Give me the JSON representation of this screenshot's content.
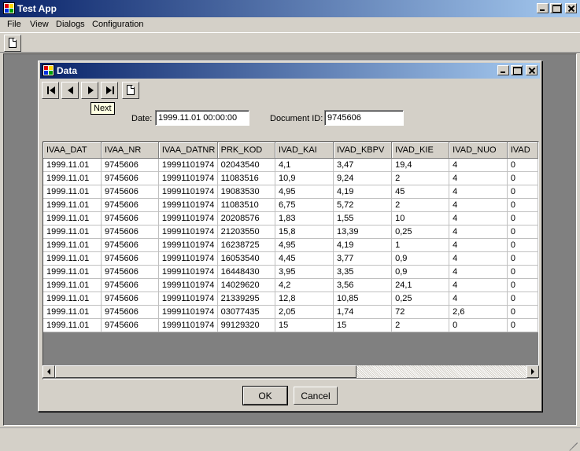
{
  "app": {
    "title": "Test App",
    "icon": "app-icon"
  },
  "menu": [
    "File",
    "View",
    "Dialogs",
    "Configuration"
  ],
  "toolbar": {
    "new_icon": "new-document-icon"
  },
  "dialog": {
    "title": "Data",
    "tooltip": "Next",
    "date_label": "Date:",
    "date_value": "1999.11.01 00:00:00",
    "docid_label": "Document ID:",
    "docid_value": "9745606",
    "ok_label": "OK",
    "cancel_label": "Cancel"
  },
  "grid": {
    "columns": [
      "IVAA_DAT",
      "IVAA_NR",
      "IVAA_DATNR",
      "PRK_KOD",
      "IVAD_KAI",
      "IVAD_KBPV",
      "IVAD_KIE",
      "IVAD_NUO",
      "IVAD"
    ],
    "rows": [
      [
        "1999.11.01",
        "9745606",
        "19991101974",
        "02043540",
        "4,1",
        "3,47",
        "19,4",
        "4",
        "0"
      ],
      [
        "1999.11.01",
        "9745606",
        "19991101974",
        "11083516",
        "10,9",
        "9,24",
        "2",
        "4",
        "0"
      ],
      [
        "1999.11.01",
        "9745606",
        "19991101974",
        "19083530",
        "4,95",
        "4,19",
        "45",
        "4",
        "0"
      ],
      [
        "1999.11.01",
        "9745606",
        "19991101974",
        "11083510",
        "6,75",
        "5,72",
        "2",
        "4",
        "0"
      ],
      [
        "1999.11.01",
        "9745606",
        "19991101974",
        "20208576",
        "1,83",
        "1,55",
        "10",
        "4",
        "0"
      ],
      [
        "1999.11.01",
        "9745606",
        "19991101974",
        "21203550",
        "15,8",
        "13,39",
        "0,25",
        "4",
        "0"
      ],
      [
        "1999.11.01",
        "9745606",
        "19991101974",
        "16238725",
        "4,95",
        "4,19",
        "1",
        "4",
        "0"
      ],
      [
        "1999.11.01",
        "9745606",
        "19991101974",
        "16053540",
        "4,45",
        "3,77",
        "0,9",
        "4",
        "0"
      ],
      [
        "1999.11.01",
        "9745606",
        "19991101974",
        "16448430",
        "3,95",
        "3,35",
        "0,9",
        "4",
        "0"
      ],
      [
        "1999.11.01",
        "9745606",
        "19991101974",
        "14029620",
        "4,2",
        "3,56",
        "24,1",
        "4",
        "0"
      ],
      [
        "1999.11.01",
        "9745606",
        "19991101974",
        "21339295",
        "12,8",
        "10,85",
        "0,25",
        "4",
        "0"
      ],
      [
        "1999.11.01",
        "9745606",
        "19991101974",
        "03077435",
        "2,05",
        "1,74",
        "72",
        "2,6",
        "0"
      ],
      [
        "1999.11.01",
        "9745606",
        "19991101974",
        "99129320",
        "15",
        "15",
        "2",
        "0",
        "0"
      ]
    ]
  }
}
